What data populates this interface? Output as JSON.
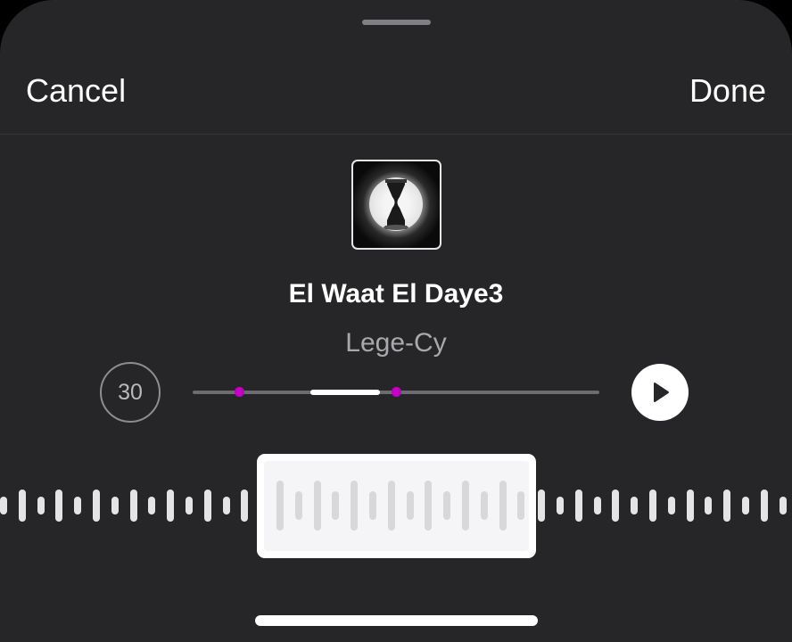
{
  "header": {
    "cancel_label": "Cancel",
    "done_label": "Done"
  },
  "track": {
    "title": "El Waat El Daye3",
    "artist": "Lege-Cy",
    "artwork_icon": "hourglass-artwork"
  },
  "player": {
    "clip_duration": "30",
    "play_icon": "play-icon",
    "selection_start_fraction": 0.29,
    "selection_end_fraction": 0.46,
    "marker_fractions": [
      0.115,
      0.5
    ]
  },
  "waveform": {
    "selection_label": ""
  },
  "colors": {
    "background": "#262527",
    "accent_marker": "#c400c4",
    "text_primary": "#ffffff",
    "text_secondary": "#a9a8ac"
  }
}
